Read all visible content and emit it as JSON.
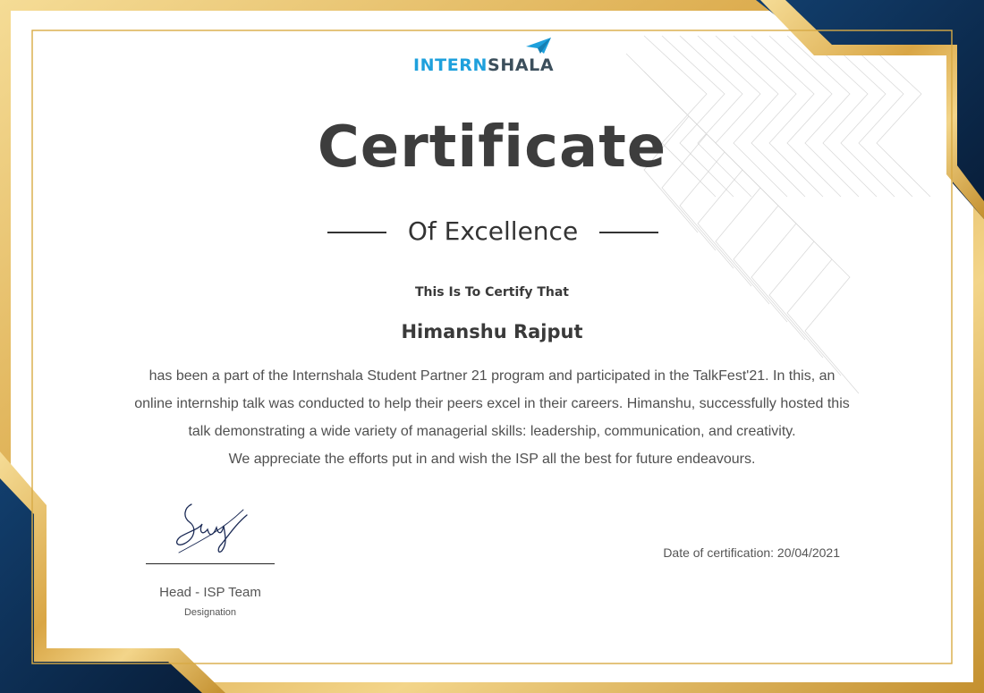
{
  "certificate": {
    "logo": {
      "part1": "INTERN",
      "part2": "SHALA"
    },
    "title": "Certificate",
    "subtitle": "Of Excellence",
    "certify_line": "This Is To Certify That",
    "recipient_name": "Himanshu Rajput",
    "body_paragraph": "has been a part of the Internshala Student Partner 21 program and participated in the TalkFest'21. In this, an online internship talk was conducted to help their peers excel in their careers. Himanshu, successfully hosted this talk demonstrating a wide variety of managerial skills: leadership, communication, and creativity.",
    "appreciation_line": "We appreciate the efforts put in and wish the ISP all the best for future endeavours.",
    "signatory_title": "Head - ISP Team",
    "signatory_designation": "Designation",
    "date_label": "Date of certification: 20/04/2021"
  },
  "colors": {
    "navy": "#0d2f55",
    "gold": "#e2b456",
    "gold_light": "#f5d98f",
    "gold_dark": "#c08d2d",
    "text_dark": "#3d3d3d",
    "brand_blue": "#1ea0dc",
    "brand_dark": "#3c4f5c"
  },
  "icons": {
    "logo_mark": "paper-plane-icon",
    "signature": "signature-graphic"
  }
}
